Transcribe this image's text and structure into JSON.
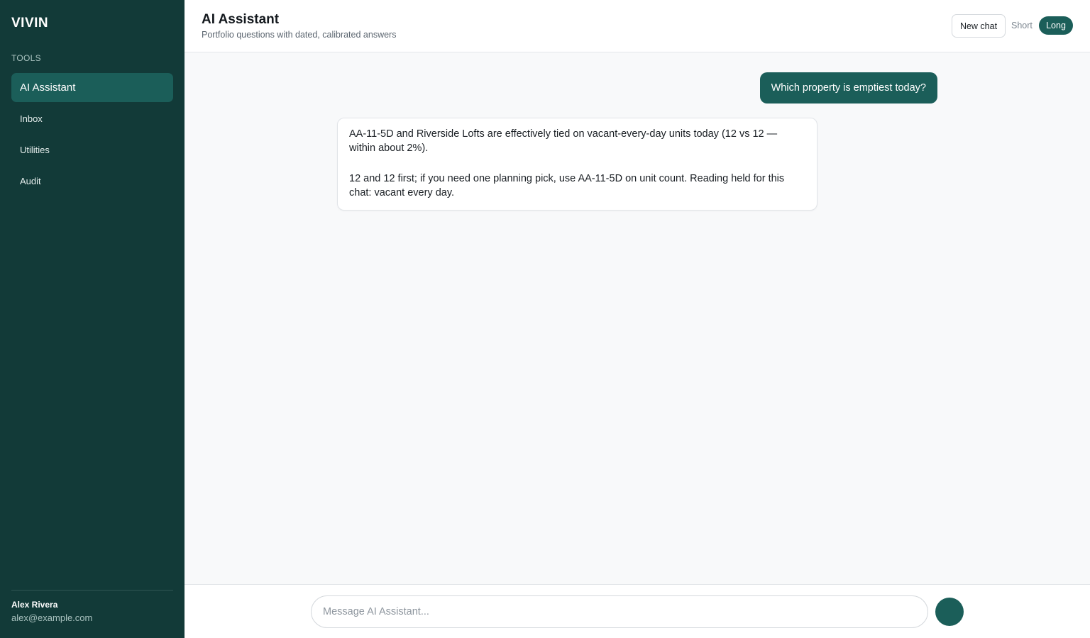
{
  "sidebar": {
    "brand": "VIVIN",
    "section_label": "TOOLS",
    "items": [
      {
        "label": "AI Assistant",
        "active": true
      },
      {
        "label": "Inbox",
        "active": false
      },
      {
        "label": "Utilities",
        "active": false
      },
      {
        "label": "Audit",
        "active": false
      }
    ],
    "user": {
      "name": "Alex Rivera",
      "email": "alex@example.com"
    }
  },
  "header": {
    "title": "AI Assistant",
    "subtitle": "Portfolio questions with dated, calibrated answers",
    "new_chat_label": "New chat",
    "length_toggle": {
      "options": [
        "Short",
        "Long"
      ],
      "selected": "Long"
    }
  },
  "chat": {
    "messages": [
      {
        "role": "user",
        "paragraphs": [
          "Which property is emptiest today?"
        ]
      },
      {
        "role": "assistant",
        "paragraphs": [
          "AA-11-5D and Riverside Lofts are effectively tied on vacant-every-day units today (12 vs 12 — within about 2%).",
          "12 and 12 first; if you need one planning pick, use AA-11-5D on unit count. Reading held for this chat: vacant every day."
        ]
      }
    ]
  },
  "composer": {
    "placeholder": "Message AI Assistant...",
    "value": ""
  },
  "colors": {
    "sidebar_bg": "#123a38",
    "accent": "#1b5e59",
    "page_bg": "#f8f9fa"
  }
}
